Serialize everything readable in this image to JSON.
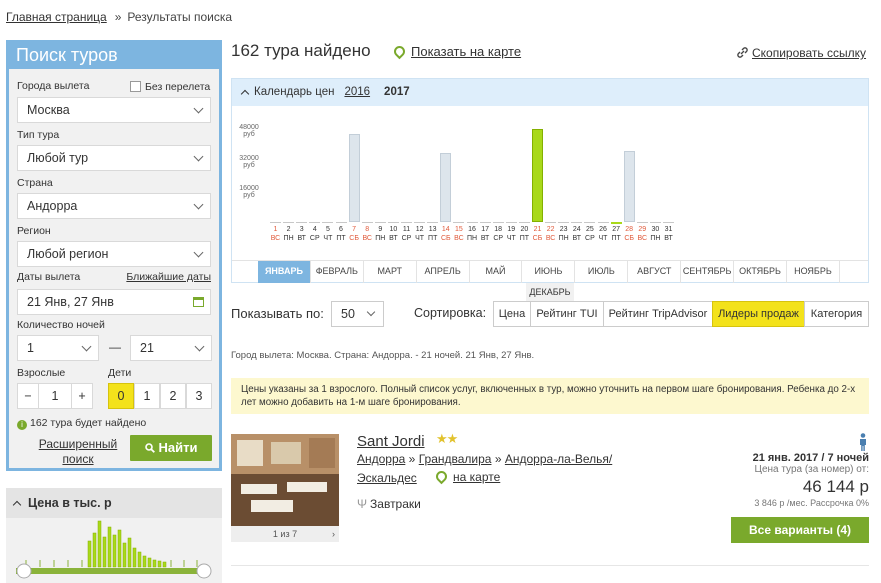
{
  "breadcrumbs": {
    "home": "Главная страница",
    "separator": "»",
    "current": "Результаты поиска"
  },
  "search": {
    "title": "Поиск туров",
    "departure_label": "Города вылета",
    "no_flight_label": "Без перелета",
    "departure_value": "Москва",
    "tour_type_label": "Тип тура",
    "tour_type_value": "Любой тур",
    "country_label": "Страна",
    "country_value": "Андорра",
    "region_label": "Регион",
    "region_value": "Любой регион",
    "dates_label": "Даты вылета",
    "nearest_dates_link": "Ближайшие даты",
    "dates_value": "21 Янв, 27 Янв",
    "nights_label": "Количество ночей",
    "nights_from": "1",
    "nights_dash": "—",
    "nights_to": "21",
    "adults_label": "Взрослые",
    "adults_minus": "−",
    "adults_value": "1",
    "adults_plus": "+",
    "children_label": "Дети",
    "children_options": [
      "0",
      "1",
      "2",
      "3"
    ],
    "found_hint": "162 тура будет найдено",
    "advanced_link": "Расширенный поиск",
    "find_button": "Найти"
  },
  "price_filter": {
    "title": "Цена в тыс. р"
  },
  "results": {
    "found_count": "162 тура найдено",
    "show_on_map": "Показать на карте",
    "copy_link": "Скопировать ссылку"
  },
  "calendar": {
    "title": "Календарь цен",
    "years": [
      "2016",
      "2017"
    ],
    "active_year": "2017",
    "y_ticks": [
      {
        "value": "48000",
        "unit": "руб"
      },
      {
        "value": "32000",
        "unit": "руб"
      },
      {
        "value": "16000",
        "unit": "руб"
      }
    ],
    "days": [
      {
        "d": "1",
        "w": "ВС",
        "red": true,
        "price": 0
      },
      {
        "d": "2",
        "w": "ПН",
        "red": false,
        "price": 0
      },
      {
        "d": "3",
        "w": "ВТ",
        "red": false,
        "price": 0
      },
      {
        "d": "4",
        "w": "СР",
        "red": false,
        "price": 0
      },
      {
        "d": "5",
        "w": "ЧТ",
        "red": false,
        "price": 0
      },
      {
        "d": "6",
        "w": "ПТ",
        "red": false,
        "price": 0
      },
      {
        "d": "7",
        "w": "СБ",
        "red": true,
        "price": 46000
      },
      {
        "d": "8",
        "w": "ВС",
        "red": true,
        "price": 0
      },
      {
        "d": "9",
        "w": "ПН",
        "red": false,
        "price": 0
      },
      {
        "d": "10",
        "w": "ВТ",
        "red": false,
        "price": 0
      },
      {
        "d": "11",
        "w": "СР",
        "red": false,
        "price": 0
      },
      {
        "d": "12",
        "w": "ЧТ",
        "red": false,
        "price": 0
      },
      {
        "d": "13",
        "w": "ПТ",
        "red": false,
        "price": 0
      },
      {
        "d": "14",
        "w": "СБ",
        "red": true,
        "price": 36000
      },
      {
        "d": "15",
        "w": "ВС",
        "red": true,
        "price": 0
      },
      {
        "d": "16",
        "w": "ПН",
        "red": false,
        "price": 0
      },
      {
        "d": "17",
        "w": "ВТ",
        "red": false,
        "price": 0
      },
      {
        "d": "18",
        "w": "СР",
        "red": false,
        "price": 0
      },
      {
        "d": "19",
        "w": "ЧТ",
        "red": false,
        "price": 0
      },
      {
        "d": "20",
        "w": "ПТ",
        "red": false,
        "price": 0
      },
      {
        "d": "21",
        "w": "СБ",
        "red": true,
        "price": 48500,
        "selected": true
      },
      {
        "d": "22",
        "w": "ВС",
        "red": true,
        "price": 0
      },
      {
        "d": "23",
        "w": "ПН",
        "red": false,
        "price": 0
      },
      {
        "d": "24",
        "w": "ВТ",
        "red": false,
        "price": 0
      },
      {
        "d": "25",
        "w": "СР",
        "red": false,
        "price": 0
      },
      {
        "d": "26",
        "w": "ЧТ",
        "red": false,
        "price": 0
      },
      {
        "d": "27",
        "w": "ПТ",
        "red": false,
        "price": 0,
        "selected": true
      },
      {
        "d": "28",
        "w": "СБ",
        "red": true,
        "price": 36800
      },
      {
        "d": "29",
        "w": "ВС",
        "red": true,
        "price": 0
      },
      {
        "d": "30",
        "w": "ПН",
        "red": false,
        "price": 0
      },
      {
        "d": "31",
        "w": "ВТ",
        "red": false,
        "price": 0
      }
    ],
    "months": [
      "ЯНВАРЬ",
      "ФЕВРАЛЬ",
      "МАРТ",
      "АПРЕЛЬ",
      "МАЙ",
      "ИЮНЬ",
      "ИЮЛЬ",
      "АВГУСТ",
      "СЕНТЯБРЬ",
      "ОКТЯБРЬ",
      "НОЯБРЬ"
    ],
    "active_month": "ЯНВАРЬ",
    "overflow_month": "ДЕКАБРЬ"
  },
  "controls": {
    "show_by_label": "Показывать по:",
    "show_by_value": "50",
    "sort_label": "Сортировка:",
    "sort_options": [
      "Цена",
      "Рейтинг TUI",
      "Рейтинг TripAdvisor",
      "Лидеры продаж",
      "Категория"
    ],
    "sort_active": "Лидеры продаж"
  },
  "filter_summary": "Город вылета: Москва. Страна: Андорра. - 21 ночей. 21 Янв, 27 Янв.",
  "notice": "Цены указаны за 1 взрослого. Полный список услуг, включенных в тур, можно уточнить на первом шаге бронирования. Ребенка до 2-х лет можно добавить на 1-м шаге бронирования.",
  "hotel": {
    "name": "Sant Jordi",
    "stars": 2,
    "stars_text": "★★",
    "location": [
      "Андорра",
      "Грандвалира",
      "Андорра-ла-Велья/",
      "Эскальдес"
    ],
    "location_sep": "»",
    "map_link": "на карте",
    "meal": "Завтраки",
    "photo_counter": "1 из 7",
    "date_nights": "21 янв. 2017 / 7 ночей",
    "price_label": "Цена тура (за номер) от:",
    "price": "46 144 р",
    "installment": "3 846 р /мес. Рассрочка 0%",
    "all_variants": "Все варианты (4)"
  },
  "colors": {
    "accent_blue": "#7db5e0",
    "green": "#7aa92c",
    "yellow": "#f3e21b",
    "bar_green": "#a9d91a"
  }
}
